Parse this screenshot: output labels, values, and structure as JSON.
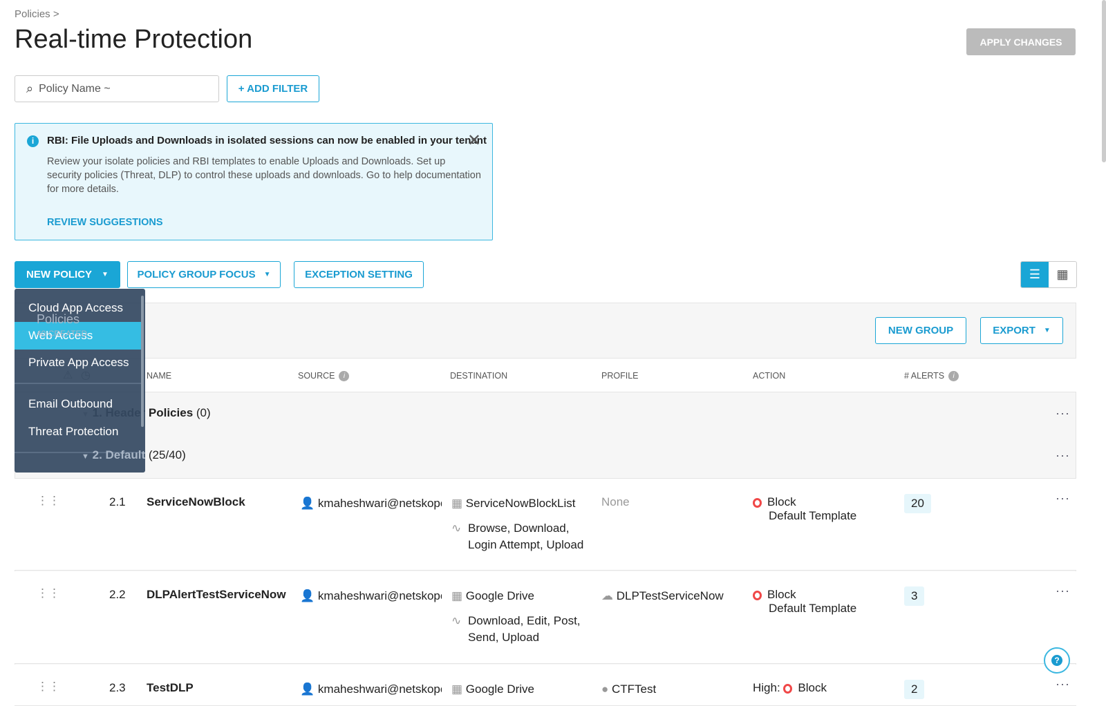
{
  "breadcrumb": "Policies >",
  "title": "Real-time Protection",
  "apply_label": "APPLY CHANGES",
  "search": {
    "placeholder": "Policy Name ~"
  },
  "add_filter_label": "+ ADD FILTER",
  "banner": {
    "heading": "RBI: File Uploads and Downloads in isolated sessions can now be enabled in your tenant",
    "body": "Review your isolate policies and RBI templates to enable Uploads and Downloads. Set up security policies (Threat, DLP) to control these uploads and downloads. Go to help documentation for more details.",
    "link": "REVIEW SUGGESTIONS"
  },
  "toolbar": {
    "new_policy": "NEW POLICY",
    "group_focus": "POLICY GROUP FOCUS",
    "exception": "EXCEPTION SETTING"
  },
  "panel": {
    "title": "Policies",
    "subtitle": "40 CREATED",
    "new_group": "NEW GROUP",
    "export": "EXPORT"
  },
  "columns": {
    "name": "NAME",
    "source": "SOURCE",
    "destination": "DESTINATION",
    "profile": "PROFILE",
    "action": "ACTION",
    "alerts": "# ALERTS"
  },
  "groups": [
    {
      "name": "1. Header Policies",
      "count": "(0)"
    },
    {
      "name": "2. Default",
      "count": "(25/40)"
    }
  ],
  "rows": [
    {
      "num": "2.1",
      "name": "ServiceNowBlock",
      "source": "kmaheshwari@netskope",
      "dest": "ServiceNowBlockList",
      "activities": "Browse, Download, Login Attempt, Upload",
      "profile": "None",
      "action": "Block",
      "template": "Default Template",
      "alerts": "20"
    },
    {
      "num": "2.2",
      "name": "DLPAlertTestServiceNow",
      "source": "kmaheshwari@netskope",
      "dest": "Google Drive",
      "activities": "Download, Edit, Post, Send, Upload",
      "profile": "DLPTestServiceNow",
      "action": "Block",
      "template": "Default Template",
      "alerts": "3"
    },
    {
      "num": "2.3",
      "name": "TestDLP",
      "source": "kmaheshwari@netskope",
      "dest": "Google Drive",
      "profile": "CTFTest",
      "action_prefix": "High:",
      "action": "Block",
      "alerts": "2"
    }
  ],
  "menu": {
    "items": [
      "Cloud App Access",
      "Web Access",
      "Private App Access",
      "Email Outbound",
      "Threat Protection"
    ],
    "selected": "Web Access"
  },
  "colors": {
    "accent": "#1aa6d6",
    "menu_bg": "#354962",
    "block": "#f04848"
  }
}
